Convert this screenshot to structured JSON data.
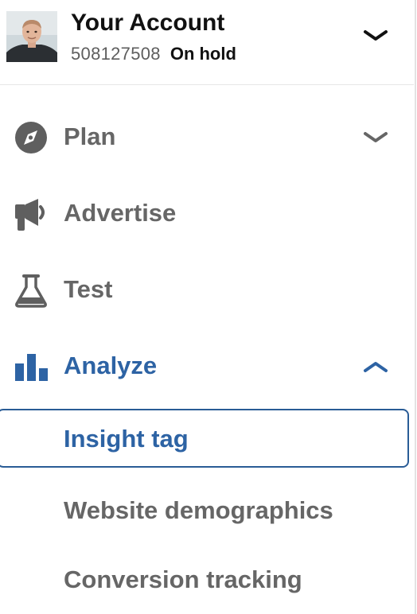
{
  "account": {
    "title": "Your Account",
    "account_id": "508127508",
    "status": "On hold",
    "avatar_icon": "user-avatar-photo",
    "expand_icon": "chevron-down-icon"
  },
  "nav": {
    "items": [
      {
        "label": "Plan",
        "icon": "compass-icon",
        "chevron": "chevron-down-icon",
        "expanded": false,
        "active": false
      },
      {
        "label": "Advertise",
        "icon": "megaphone-icon",
        "active": false
      },
      {
        "label": "Test",
        "icon": "flask-icon",
        "active": false
      },
      {
        "label": "Analyze",
        "icon": "bar-chart-icon",
        "chevron": "chevron-up-icon",
        "expanded": true,
        "active": true
      }
    ],
    "analyze_subitems": [
      {
        "label": "Insight tag",
        "selected": true
      },
      {
        "label": "Website demographics",
        "selected": false
      },
      {
        "label": "Conversion tracking",
        "selected": false
      }
    ]
  },
  "colors": {
    "accent": "#2d63a4",
    "accent_border": "#2a5c96",
    "inactive_text": "#666666",
    "icon_gray": "#5f5f5f",
    "title_text": "#111111"
  }
}
